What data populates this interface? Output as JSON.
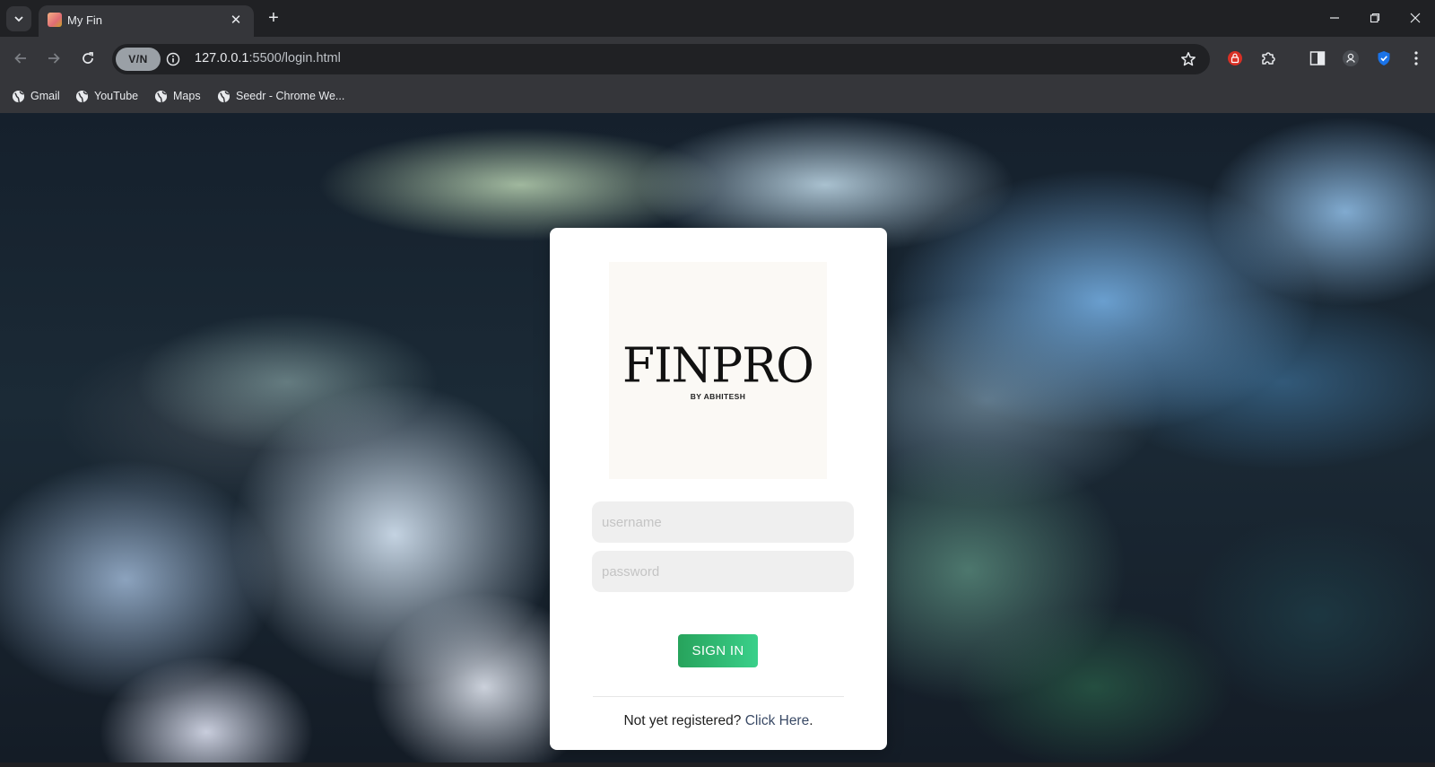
{
  "browser": {
    "tab": {
      "title": "My Fin"
    },
    "address": {
      "host": "127.0.0.1",
      "path": ":5500/login.html"
    },
    "vpn_label": "V/N",
    "bookmarks": [
      {
        "label": "Gmail"
      },
      {
        "label": "YouTube"
      },
      {
        "label": "Maps"
      },
      {
        "label": "Seedr - Chrome We..."
      }
    ]
  },
  "login": {
    "logo": {
      "brand": "FINPRO",
      "byline": "BY ABHITESH"
    },
    "username_placeholder": "username",
    "password_placeholder": "password",
    "submit_label": "SIGN IN",
    "register_prompt": "Not yet registered?",
    "register_link": "Click Here",
    "register_suffix": "."
  },
  "colors": {
    "button_start": "#27a35c",
    "button_end": "#3ad08a",
    "input_bg": "#efefef"
  }
}
